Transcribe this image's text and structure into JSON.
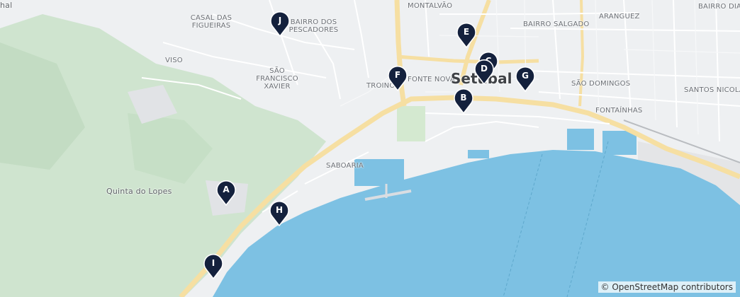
{
  "map": {
    "colors": {
      "water": "#7dc1e3",
      "land": "#eef0f2",
      "green": "#cfe4cf",
      "road_major": "#f6dfa2",
      "road_minor": "#ffffff",
      "pin": "#14213d"
    },
    "labels": {
      "casal_das_figueiras": "CASAL DAS FIGUEIRAS",
      "bairro_dos_pescadores": "BAIRRO DOS PESCADORES",
      "montalvao": "MONTALVÃO",
      "aranguez": "ARANGUEZ",
      "bairro_dias": "BAIRRO DIAS",
      "bairro_salgado": "BAIRRO SALGADO",
      "viso": "VISO",
      "sao_francisco_xavier": "SÃO FRANCISCO XAVIER",
      "fonte_nova": "FONTE NOVA",
      "troino": "TROINO",
      "setubal": "Setúbal",
      "sao_domingos": "SÃO DOMINGOS",
      "santos_nicolau": "SANTOS NICOLAU",
      "fontainhas": "FONTAÍNHAS",
      "saboaria": "SABOARIA",
      "quinta_do_lopes": "Quinta do Lopes",
      "hal": "hal"
    },
    "markers": [
      "A",
      "B",
      "C",
      "D",
      "E",
      "F",
      "G",
      "H",
      "I",
      "J"
    ],
    "attribution": "© OpenStreetMap contributors"
  }
}
